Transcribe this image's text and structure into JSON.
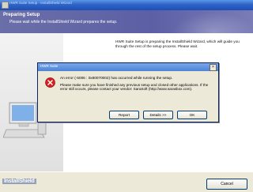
{
  "window": {
    "title": "HWR Suite Setup - InstallShield Wizard"
  },
  "header": {
    "title": "Preparing Setup",
    "subtitle": "Please wait while the InstallShield Wizard prepares the setup."
  },
  "body": {
    "description": "HWR Suite Setup is preparing the InstallShield Wizard, which will guide you through the rest of the setup process. Please wait."
  },
  "footer": {
    "brand": "InstallShield",
    "cancel_label": "Cancel"
  },
  "dialog": {
    "title": "HWR Suite",
    "close_glyph": "×",
    "message": "An error (-5006 : 0x80070002) has occurred while running the setup.",
    "details": "Please make sure you have finished any previous setup and closed other applications. If the error still occurs, please contact your vendor: SaraSoft (http://www.sarasbox.com).",
    "buttons": {
      "report": "Report",
      "details": "Details >>",
      "ok": "OK"
    }
  }
}
